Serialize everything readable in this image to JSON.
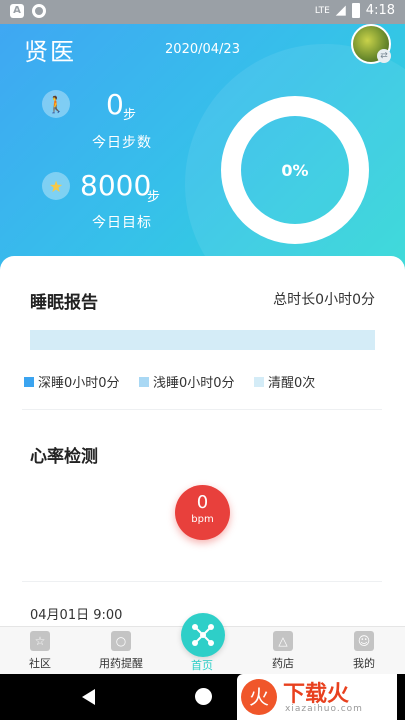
{
  "status_bar": {
    "time": "4:18",
    "network": "LTE"
  },
  "header": {
    "brand": "贤医",
    "date": "2020/04/23",
    "avatar_badge": "⇄"
  },
  "steps": {
    "value": "0",
    "unit": "步",
    "label": "今日步数"
  },
  "goal": {
    "value": "8000",
    "unit": "步",
    "label": "今日目标"
  },
  "progress": {
    "text": "0%",
    "fraction": 0
  },
  "sleep": {
    "title": "睡眠报告",
    "total": "总时长0小时0分",
    "legend": [
      {
        "label": "深睡0小时0分",
        "color": "#3ba4f0"
      },
      {
        "label": "浅睡0小时0分",
        "color": "#a9d8f4"
      },
      {
        "label": "清醒0次",
        "color": "#d4ecf7"
      }
    ]
  },
  "heart_rate": {
    "title": "心率检测",
    "value": "0",
    "unit": "bpm"
  },
  "record": {
    "time": "04月01日 9:00"
  },
  "nav": {
    "items": [
      {
        "label": "社区",
        "icon": "star-icon"
      },
      {
        "label": "用药提醒",
        "icon": "pill-icon"
      },
      {
        "label": "首页",
        "icon": "home-icon"
      },
      {
        "label": "药店",
        "icon": "store-icon"
      },
      {
        "label": "我的",
        "icon": "profile-icon"
      }
    ]
  },
  "watermark": {
    "logo": "火",
    "text": "下载火",
    "sub": "xiazaihuo.com"
  }
}
